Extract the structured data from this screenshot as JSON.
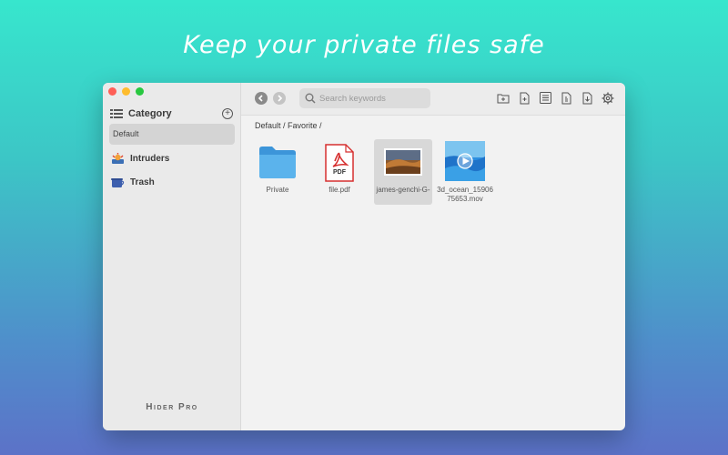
{
  "headline": "Keep your private files safe",
  "sidebar": {
    "category_label": "Category",
    "selected_category": "Default",
    "items": [
      {
        "label": "Intruders",
        "icon": "intruder-icon"
      },
      {
        "label": "Trash",
        "icon": "trash-icon"
      }
    ],
    "brand": "Hider Pro"
  },
  "toolbar": {
    "search_placeholder": "Search keywords",
    "tools": [
      "new-folder-icon",
      "new-file-icon",
      "list-view-icon",
      "export-icon",
      "download-icon",
      "gear-icon"
    ]
  },
  "breadcrumb": "Default / Favorite /",
  "files": [
    {
      "name": "Private",
      "type": "folder"
    },
    {
      "name": "file.pdf",
      "type": "pdf",
      "badge": "PDF"
    },
    {
      "name": "james-genchi-G-",
      "type": "image"
    },
    {
      "name": "3d_ocean_1590675653.mov",
      "type": "video"
    }
  ],
  "colors": {
    "accent_folder": "#4aa3e0",
    "pdf_red": "#d62f2f",
    "traffic_red": "#fe5f57",
    "traffic_yellow": "#febc2e",
    "traffic_green": "#28c840"
  }
}
